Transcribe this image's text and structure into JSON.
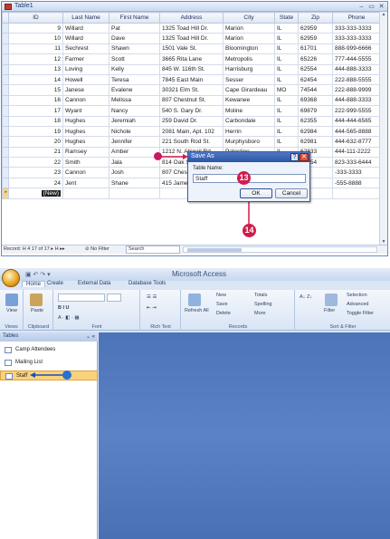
{
  "table_window": {
    "title": "Table1",
    "columns": [
      "ID",
      "Last Name",
      "First Name",
      "Address",
      "City",
      "State",
      "Zip",
      "Phone"
    ],
    "rows": [
      [
        "9",
        "Willard",
        "Pat",
        "1325 Toad Hill Dr.",
        "Marion",
        "IL",
        "62959",
        "333-333-3333"
      ],
      [
        "10",
        "Willard",
        "Dave",
        "1325 Toad Hill Dr.",
        "Marion",
        "IL",
        "62959",
        "333-333-3333"
      ],
      [
        "11",
        "Sechrest",
        "Shawn",
        "1501 Vale St.",
        "Bloomington",
        "IL",
        "61701",
        "888-999-6666"
      ],
      [
        "12",
        "Farmer",
        "Scott",
        "3665 Rita Lane",
        "Metropolis",
        "IL",
        "65226",
        "777-444-5555"
      ],
      [
        "13",
        "Loving",
        "Kelly",
        "845 W. 116th St.",
        "Harrisburg",
        "IL",
        "62554",
        "444-888-3333"
      ],
      [
        "14",
        "Howell",
        "Teresa",
        "7845 East Main",
        "Sesser",
        "IL",
        "62454",
        "222-888-5555"
      ],
      [
        "15",
        "Janese",
        "Evalene",
        "30321 Elm St.",
        "Cape Girardeau",
        "MO",
        "74544",
        "222-888-9999"
      ],
      [
        "16",
        "Cannon",
        "Melissa",
        "807 Chestnut St.",
        "Kewanee",
        "IL",
        "69368",
        "444-888-3333"
      ],
      [
        "17",
        "Wyant",
        "Nancy",
        "540 S. Gary Dr.",
        "Moline",
        "IL",
        "69879",
        "222-999-5555"
      ],
      [
        "18",
        "Hughes",
        "Jeremiah",
        "259 David Dr.",
        "Carbondale",
        "IL",
        "62355",
        "444-444-6565"
      ],
      [
        "19",
        "Hughes",
        "Nichole",
        "2081 Main, Apt. 102",
        "Herrin",
        "IL",
        "62984",
        "444-565-8888"
      ],
      [
        "20",
        "Hughes",
        "Jennifer",
        "221 South Rod St.",
        "Murphysboro",
        "IL",
        "62981",
        "444-632-8777"
      ],
      [
        "21",
        "Ramsey",
        "Amber",
        "1212 N. Abigail Rd.",
        "Palestine",
        "IL",
        "62833",
        "444-111-2222"
      ],
      [
        "22",
        "Smith",
        "Jala",
        "814 Oak Street",
        "Paducah",
        "KY",
        "74454",
        "823-333-6444"
      ],
      [
        "23",
        "Cannon",
        "Josh",
        "807 Chestnut St.",
        "",
        "",
        "",
        "-333-3333"
      ],
      [
        "24",
        "Jent",
        "Shane",
        "415 James St.",
        "",
        "",
        "",
        "-555-8888"
      ]
    ],
    "new_row_label": "(New)",
    "new_row_marker": "*",
    "record_nav": "Record: H  4  17 of 17  ▸  H  ▸▸",
    "filter_status": "No Filter",
    "search_label": "Search",
    "controls": {
      "minimize": "–",
      "restore": "▭",
      "close": "✕"
    }
  },
  "save_as_dialog": {
    "title": "Save As",
    "help": "?",
    "close": "✕",
    "field_label": "Table Name:",
    "field_value": "Staff",
    "ok_label": "OK",
    "cancel_label": "Cancel"
  },
  "callouts": {
    "step13": "13",
    "step14": "14"
  },
  "access_window": {
    "title": "Microsoft Access",
    "tabs": [
      "Home",
      "Create",
      "External Data",
      "Database Tools"
    ],
    "active_tab": "Home",
    "ribbon_groups": [
      "Views",
      "Clipboard",
      "Font",
      "Rich Text",
      "Records",
      "Sort & Filter"
    ],
    "ribbon_buttons": {
      "view": "View",
      "paste": "Paste",
      "refresh": "Refresh All",
      "new": "New",
      "save": "Save",
      "delete": "Delete",
      "totals": "Totals",
      "spelling": "Spelling",
      "more": "More",
      "filter": "Filter",
      "selection": "Selection",
      "advanced": "Advanced",
      "toggle_filter": "Toggle Filter"
    },
    "nav_pane_title": "Tables",
    "nav_items": [
      "Camp Attendees",
      "Mailing List",
      "Staff"
    ],
    "selected_nav_item": "Staff"
  },
  "colors": {
    "accent_callout": "#d11b4b",
    "pointer_dot": "#2a6fd1",
    "selection": "#fbd27b"
  }
}
